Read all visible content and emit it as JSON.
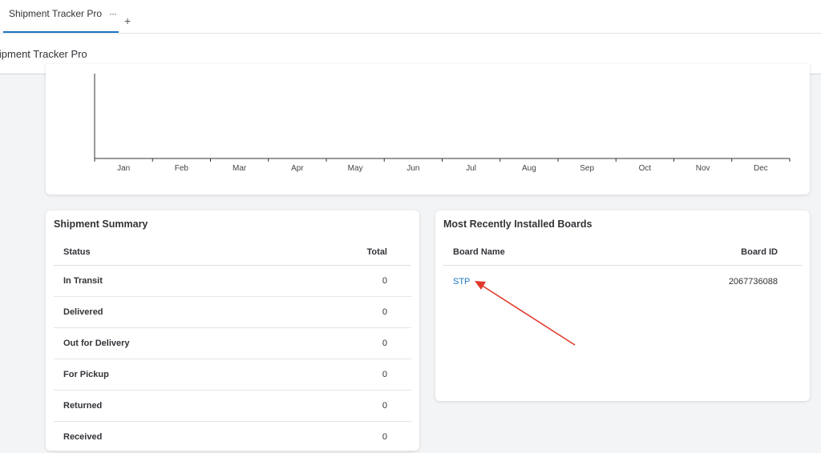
{
  "tab": {
    "label": "Shipment Tracker Pro",
    "more": "···",
    "add": "+"
  },
  "header": {
    "title": "Shipment Tracker Pro"
  },
  "chart_data": {
    "type": "line",
    "categories": [
      "Jan",
      "Feb",
      "Mar",
      "Apr",
      "May",
      "Jun",
      "Jul",
      "Aug",
      "Sep",
      "Oct",
      "Nov",
      "Dec"
    ],
    "series": [],
    "title": "",
    "xlabel": "",
    "ylabel": ""
  },
  "summary": {
    "title": "Shipment Summary",
    "col_status": "Status",
    "col_total": "Total",
    "rows": [
      {
        "status": "In Transit",
        "total": "0"
      },
      {
        "status": "Delivered",
        "total": "0"
      },
      {
        "status": "Out for Delivery",
        "total": "0"
      },
      {
        "status": "For Pickup",
        "total": "0"
      },
      {
        "status": "Returned",
        "total": "0"
      },
      {
        "status": "Received",
        "total": "0"
      }
    ]
  },
  "boards": {
    "title": "Most Recently Installed Boards",
    "col_name": "Board Name",
    "col_id": "Board ID",
    "rows": [
      {
        "name": "STP",
        "id": "2067736088"
      }
    ]
  },
  "annotation": {
    "arrow_color": "#e0392b"
  }
}
